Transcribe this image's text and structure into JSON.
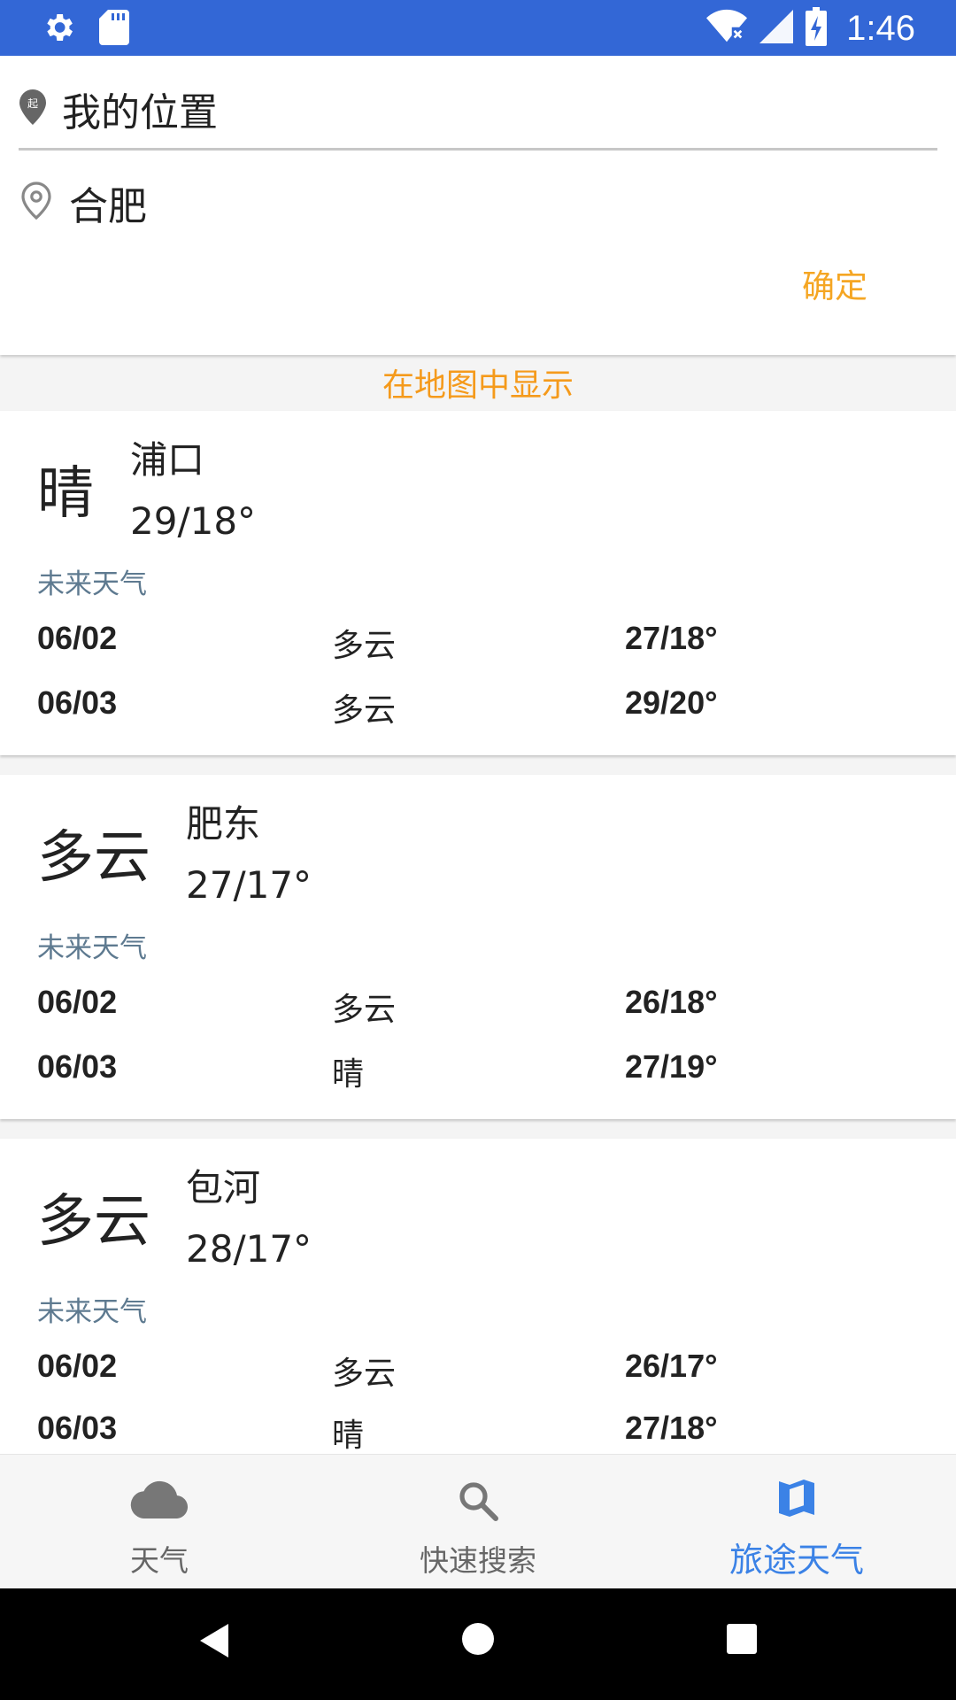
{
  "status_bar": {
    "time": "1:46",
    "icons": [
      "gear-icon",
      "sd-card-icon",
      "wifi-off-icon",
      "signal-icon",
      "battery-charging-icon"
    ]
  },
  "route": {
    "from": "我的位置",
    "to": "合肥",
    "confirm_label": "确定"
  },
  "show_map_label": "在地图中显示",
  "cards": [
    {
      "condition": "晴",
      "city": "浦口",
      "temp": "29/18°",
      "future_label": "未来天气",
      "forecast": [
        {
          "date": "06/02",
          "condition": "多云",
          "temp": "27/18°"
        },
        {
          "date": "06/03",
          "condition": "多云",
          "temp": "29/20°"
        }
      ]
    },
    {
      "condition": "多云",
      "city": "肥东",
      "temp": "27/17°",
      "future_label": "未来天气",
      "forecast": [
        {
          "date": "06/02",
          "condition": "多云",
          "temp": "26/18°"
        },
        {
          "date": "06/03",
          "condition": "晴",
          "temp": "27/19°"
        }
      ]
    },
    {
      "condition": "多云",
      "city": "包河",
      "temp": "28/17°",
      "future_label": "未来天气",
      "forecast": [
        {
          "date": "06/02",
          "condition": "多云",
          "temp": "26/17°"
        },
        {
          "date": "06/03",
          "condition": "晴",
          "temp": "27/18°"
        }
      ]
    }
  ],
  "bottom_nav": {
    "items": [
      {
        "label": "天气",
        "icon": "cloud-icon"
      },
      {
        "label": "快速搜索",
        "icon": "search-icon"
      },
      {
        "label": "旅途天气",
        "icon": "map-icon",
        "active": true
      }
    ]
  },
  "colors": {
    "status_bar": "#3367d6",
    "accent_orange": "#f5a623",
    "active_nav": "#3b82e6",
    "future_label": "#5e7a90"
  }
}
